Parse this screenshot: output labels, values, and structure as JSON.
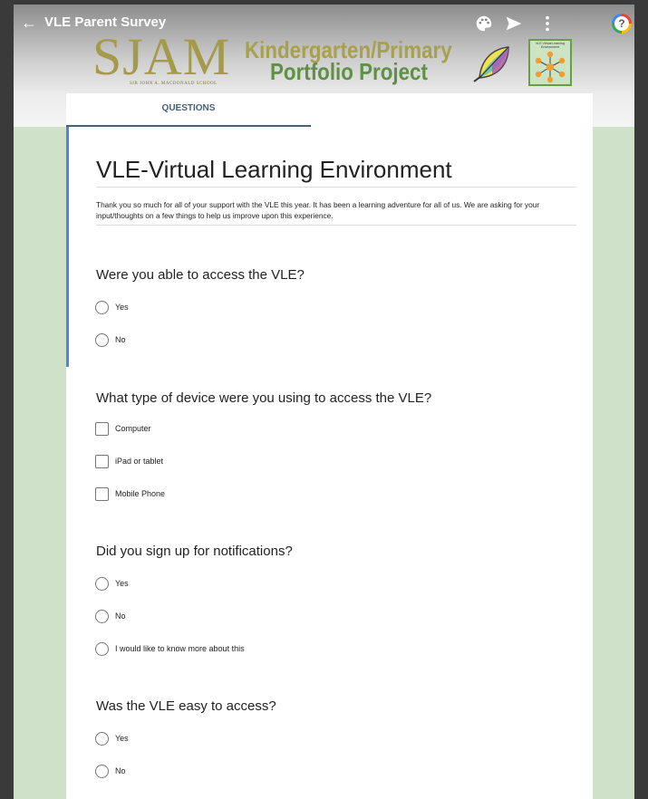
{
  "app": {
    "back_arrow": "←",
    "title": "VLE Parent Survey",
    "icons": [
      "palette-icon",
      "send-icon",
      "more-vert-icon",
      "help-icon"
    ],
    "help_glyph": "?"
  },
  "banner": {
    "school_mark": "SJAM",
    "school_name": "SIR JOHN A. MACDONALD SCHOOL",
    "project_line1": "Kindergarten/Primary",
    "project_line2": "Portfolio Project",
    "vle_logo_text": "VLE Virtual Learning Environment"
  },
  "tabs": {
    "questions": "QUESTIONS"
  },
  "form": {
    "title": "VLE-Virtual Learning Environment",
    "description": "Thank you so much for all of your support with the VLE this year.  It has been a learning adventure for all of us.  We are asking for your input/thoughts on a few things to help us improve upon this experience.",
    "questions": [
      {
        "text": "Were you able to access the VLE?",
        "type": "radio",
        "options": [
          "Yes",
          "No"
        ]
      },
      {
        "text": "What type of device were you using to access the VLE?",
        "type": "checkbox",
        "options": [
          "Computer",
          "iPad or tablet",
          "Mobile Phone"
        ]
      },
      {
        "text": "Did you sign up for notifications?",
        "type": "radio",
        "options": [
          "Yes",
          "No",
          "I would like to know more about this"
        ]
      },
      {
        "text": "Was the VLE easy to access?",
        "type": "radio",
        "options": [
          "Yes",
          "No"
        ]
      }
    ]
  },
  "colors": {
    "background": "#cfe2c9",
    "accent": "#4a86e8",
    "tab": "#46617a",
    "kindergarten_text": "#a7a04c",
    "portfolio_text": "#5e9144"
  }
}
